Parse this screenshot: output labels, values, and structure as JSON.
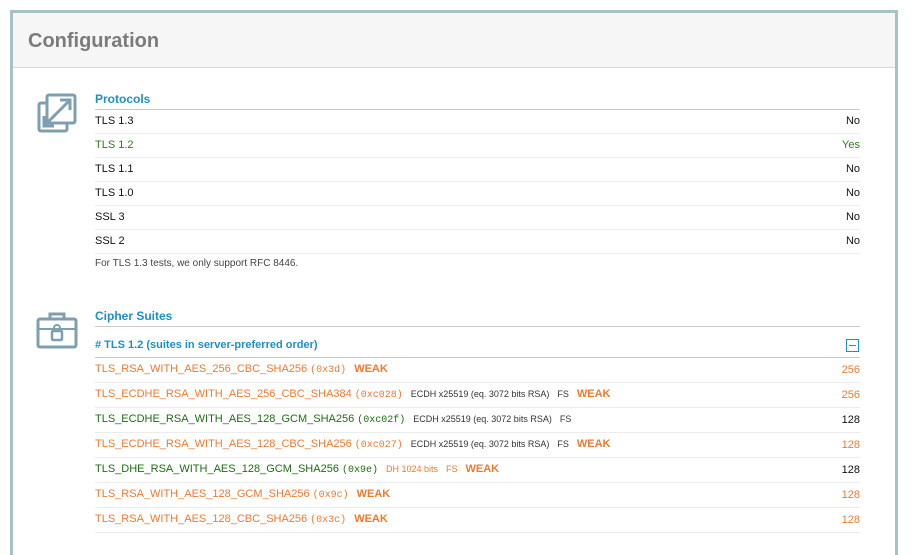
{
  "page": {
    "title": "Configuration"
  },
  "protocols": {
    "title": "Protocols",
    "icon": "resize-arrows-icon",
    "rows": [
      {
        "name": "TLS 1.3",
        "value": "No",
        "state": "no"
      },
      {
        "name": "TLS 1.2",
        "value": "Yes",
        "state": "yes"
      },
      {
        "name": "TLS 1.1",
        "value": "No",
        "state": "no"
      },
      {
        "name": "TLS 1.0",
        "value": "No",
        "state": "no"
      },
      {
        "name": "SSL 3",
        "value": "No",
        "state": "no"
      },
      {
        "name": "SSL 2",
        "value": "No",
        "state": "no"
      }
    ],
    "note": "For TLS 1.3 tests, we only support RFC 8446."
  },
  "ciphers": {
    "title": "Cipher Suites",
    "icon": "toolbox-lock-icon",
    "group_label": "# TLS 1.2 (suites in server-preferred order)",
    "collapse_icon": "minus-square-icon",
    "colors": {
      "weak": "#ec7a2f",
      "good": "#1e6e12",
      "accent": "#1f8fc6"
    },
    "rows": [
      {
        "name": "TLS_RSA_WITH_AES_256_CBC_SHA256",
        "code": "(0x3d)",
        "detail": "",
        "fs": "",
        "weak": "WEAK",
        "bits": "256",
        "state": "weak"
      },
      {
        "name": "TLS_ECDHE_RSA_WITH_AES_256_CBC_SHA384",
        "code": "(0xc028)",
        "detail": "ECDH x25519 (eq. 3072 bits RSA)",
        "fs": "FS",
        "weak": "WEAK",
        "bits": "256",
        "state": "weak"
      },
      {
        "name": "TLS_ECDHE_RSA_WITH_AES_128_GCM_SHA256",
        "code": "(0xc02f)",
        "detail": "ECDH x25519 (eq. 3072 bits RSA)",
        "fs": "FS",
        "weak": "",
        "bits": "128",
        "state": "good"
      },
      {
        "name": "TLS_ECDHE_RSA_WITH_AES_128_CBC_SHA256",
        "code": "(0xc027)",
        "detail": "ECDH x25519 (eq. 3072 bits RSA)",
        "fs": "FS",
        "weak": "WEAK",
        "bits": "128",
        "state": "weak"
      },
      {
        "name": "TLS_DHE_RSA_WITH_AES_128_GCM_SHA256",
        "code": "(0x9e)",
        "detail": "DH 1024 bits",
        "fs": "FS",
        "weak": "WEAK",
        "bits": "128",
        "state": "good",
        "detail_weak": true
      },
      {
        "name": "TLS_RSA_WITH_AES_128_GCM_SHA256",
        "code": "(0x9c)",
        "detail": "",
        "fs": "",
        "weak": "WEAK",
        "bits": "128",
        "state": "weak"
      },
      {
        "name": "TLS_RSA_WITH_AES_128_CBC_SHA256",
        "code": "(0x3c)",
        "detail": "",
        "fs": "",
        "weak": "WEAK",
        "bits": "128",
        "state": "weak"
      }
    ]
  }
}
